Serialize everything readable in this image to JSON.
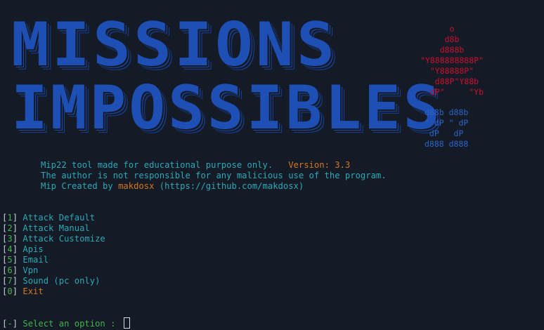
{
  "banner": {
    "line1": "MISSIONS",
    "line2": "IMPOSSIBLES"
  },
  "ascii_art": {
    "red": "      o\n     d8b\n    d888b\n\"Y888888888P\"\n  \"Y88888P\"\n   d88P\"Y88b\n  dP\"     \"Yb",
    "blue": "d88b d88b\n\" dP \" dP\n dP   dP\nd888 d888"
  },
  "info": {
    "line1_text": "Mip22 tool made for educational purpose only.   ",
    "version": "Version: 3.3",
    "line2": "The author is not responsible for any malicious use of the program.",
    "line3_prefix": "Mip Created by ",
    "author": "makdosx",
    "line3_suffix": " (https://github.com/makdosx)"
  },
  "menu": [
    {
      "num": "1",
      "label": "Attack Default"
    },
    {
      "num": "2",
      "label": "Attack Manual"
    },
    {
      "num": "3",
      "label": "Attack Customize"
    },
    {
      "num": "4",
      "label": "Apis"
    },
    {
      "num": "5",
      "label": "Email"
    },
    {
      "num": "6",
      "label": "Vpn"
    },
    {
      "num": "7",
      "label": "Sound (pc only)"
    },
    {
      "num": "0",
      "label": "Exit"
    }
  ],
  "prompt": {
    "marker": "-",
    "text": " Select an option : "
  },
  "colors": {
    "background": "#141b27",
    "banner_blue": "#1e4fb5",
    "ascii_red": "#c8102e",
    "teal": "#2aa9b5",
    "orange": "#d5761e",
    "green": "#3fb44b"
  }
}
